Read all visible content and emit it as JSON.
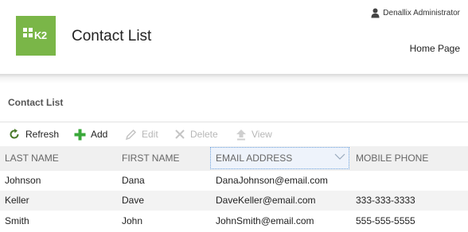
{
  "header": {
    "app_title": "Contact List",
    "logo_text": "K2",
    "user_name": "Denallix Administrator",
    "home_link": "Home Page",
    "brand_color": "#7ab648"
  },
  "section": {
    "title": "Contact List"
  },
  "toolbar": {
    "refresh": "Refresh",
    "add": "Add",
    "edit": "Edit",
    "delete": "Delete",
    "view": "View"
  },
  "table": {
    "columns": [
      "LAST NAME",
      "FIRST NAME",
      "EMAIL ADDRESS",
      "MOBILE PHONE"
    ],
    "rows": [
      {
        "last": "Johnson",
        "first": "Dana",
        "email": "DanaJohnson@email.com",
        "phone": ""
      },
      {
        "last": "Keller",
        "first": "Dave",
        "email": "DaveKeller@email.com",
        "phone": "333-333-3333"
      },
      {
        "last": "Smith",
        "first": "John",
        "email": "JohnSmith@email.com",
        "phone": "555-555-5555"
      }
    ]
  }
}
